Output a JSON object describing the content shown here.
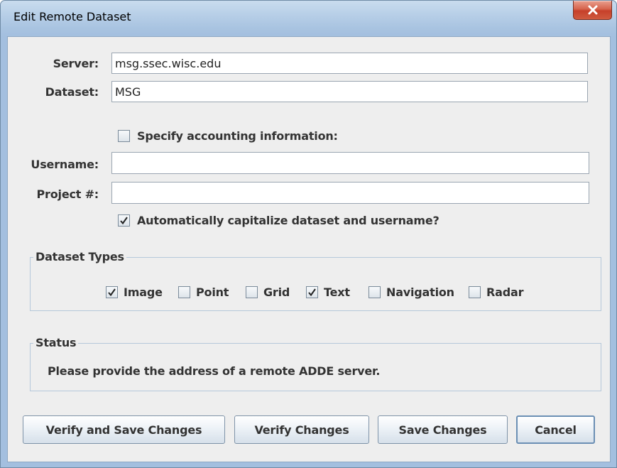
{
  "window": {
    "title": "Edit Remote Dataset"
  },
  "form": {
    "server_label": "Server:",
    "server_value": "msg.ssec.wisc.edu",
    "dataset_label": "Dataset:",
    "dataset_value": "MSG",
    "accounting_label": "Specify accounting information:",
    "accounting_checked": false,
    "username_label": "Username:",
    "username_value": "",
    "project_label": "Project #:",
    "project_value": "",
    "capitalize_label": "Automatically capitalize dataset and username?",
    "capitalize_checked": true
  },
  "dataset_types": {
    "title": "Dataset Types",
    "types": [
      {
        "label": "Image",
        "checked": true
      },
      {
        "label": "Point",
        "checked": false
      },
      {
        "label": "Grid",
        "checked": false
      },
      {
        "label": "Text",
        "checked": true
      },
      {
        "label": "Navigation",
        "checked": false
      },
      {
        "label": "Radar",
        "checked": false
      }
    ]
  },
  "status": {
    "title": "Status",
    "message": "Please provide the address of a remote ADDE server."
  },
  "buttons": {
    "verify_save": "Verify and Save Changes",
    "verify": "Verify Changes",
    "save": "Save Changes",
    "cancel": "Cancel"
  },
  "colors": {
    "titlebar": "#b9d0e8",
    "client_bg": "#eeeeee",
    "close_button": "#c6402a"
  }
}
